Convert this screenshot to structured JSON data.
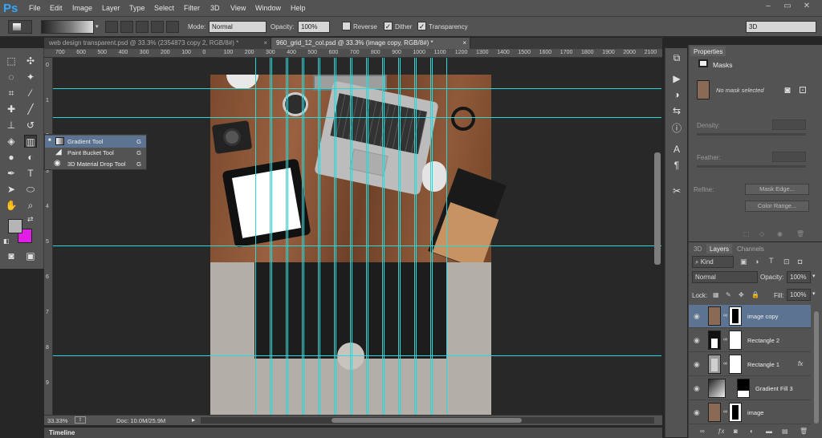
{
  "app": {
    "logo": "Ps",
    "workspace": "3D",
    "window_controls": [
      "–",
      "▭",
      "✕"
    ]
  },
  "menu": [
    "File",
    "Edit",
    "Image",
    "Layer",
    "Type",
    "Select",
    "Filter",
    "3D",
    "View",
    "Window",
    "Help"
  ],
  "options": {
    "mode_label": "Mode:",
    "mode_value": "Normal",
    "opacity_label": "Opacity:",
    "opacity_value": "100%",
    "reverse_label": "Reverse",
    "reverse_checked": false,
    "dither_label": "Dither",
    "dither_checked": true,
    "transparency_label": "Transparency",
    "transparency_checked": true
  },
  "doc_tabs": [
    {
      "title": "web design transparent.psd @ 33.3% (2354873 copy 2, RGB/8#) *",
      "active": false
    },
    {
      "title": "960_grid_12_col.psd @ 33.3% (image copy, RGB/8#) *",
      "active": true
    }
  ],
  "ruler_h": [
    "700",
    "600",
    "500",
    "400",
    "300",
    "200",
    "100",
    "0",
    "100",
    "200",
    "300",
    "400",
    "500",
    "600",
    "700",
    "800",
    "900",
    "1000",
    "1100",
    "1200",
    "1300",
    "1400",
    "1500",
    "1600",
    "1700",
    "1800",
    "1900",
    "2000",
    "2100"
  ],
  "ruler_v": [
    "0",
    "1",
    "2",
    "3",
    "4",
    "5",
    "6",
    "7",
    "8",
    "9"
  ],
  "flyout": [
    {
      "name": "Gradient Tool",
      "key": "G",
      "active": true
    },
    {
      "name": "Paint Bucket Tool",
      "key": "G",
      "active": false
    },
    {
      "name": "3D Material Drop Tool",
      "key": "G",
      "active": false
    }
  ],
  "status": {
    "zoom": "33.33%",
    "doc": "Doc: 10.0M/25.9M"
  },
  "timeline": "Timeline",
  "properties": {
    "tab": "Properties",
    "title": "Masks",
    "no_mask": "No mask selected",
    "density_label": "Density:",
    "feather_label": "Feather:",
    "refine_label": "Refine:",
    "mask_edge": "Mask Edge...",
    "color_range": "Color Range..."
  },
  "layers_panel": {
    "tabs": [
      "3D",
      "Layers",
      "Channels"
    ],
    "active_tab": "Layers",
    "kind": "Kind",
    "blend": "Normal",
    "opacity_label": "Opacity:",
    "opacity": "100%",
    "lock_label": "Lock:",
    "fill_label": "Fill:",
    "fill": "100%",
    "layers": [
      {
        "name": "image copy",
        "selected": true,
        "fx": ""
      },
      {
        "name": "Rectangle 2",
        "selected": false,
        "fx": ""
      },
      {
        "name": "Rectangle 1",
        "selected": false,
        "fx": "fx"
      },
      {
        "name": "Gradient Fill 3",
        "selected": false,
        "fx": ""
      },
      {
        "name": "image",
        "selected": false,
        "fx": ""
      }
    ]
  },
  "colors": {
    "foreground": "#b5b5b5",
    "background": "#e21ee6",
    "guide": "#29d8d8",
    "selection": "#5c7391"
  }
}
